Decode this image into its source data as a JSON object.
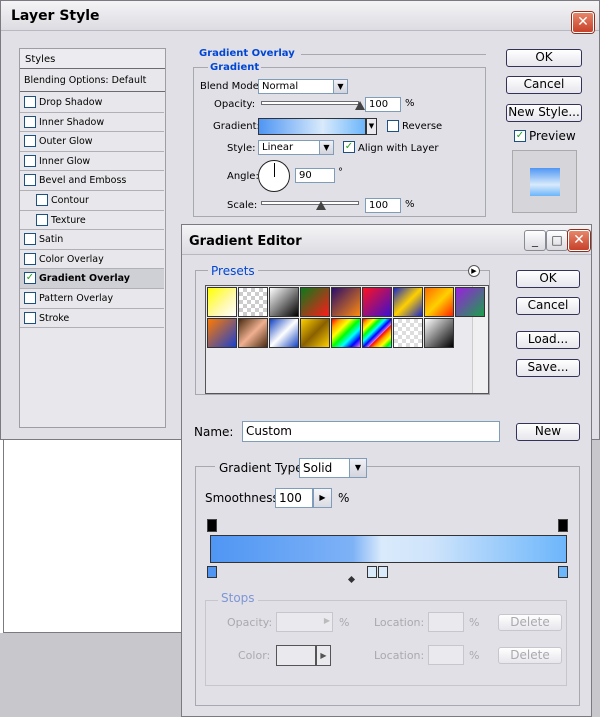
{
  "layer_style": {
    "title": "Layer Style",
    "close": "✕",
    "styles_header": "Styles",
    "blending_options": "Blending Options: Default",
    "effects": [
      {
        "label": "Drop Shadow",
        "checked": false
      },
      {
        "label": "Inner Shadow",
        "checked": false
      },
      {
        "label": "Outer Glow",
        "checked": false
      },
      {
        "label": "Inner Glow",
        "checked": false
      },
      {
        "label": "Bevel and Emboss",
        "checked": false
      },
      {
        "label": "Contour",
        "checked": false
      },
      {
        "label": "Texture",
        "checked": false
      },
      {
        "label": "Satin",
        "checked": false
      },
      {
        "label": "Color Overlay",
        "checked": false
      },
      {
        "label": "Gradient Overlay",
        "checked": true
      },
      {
        "label": "Pattern Overlay",
        "checked": false
      },
      {
        "label": "Stroke",
        "checked": false
      }
    ],
    "section_title": "Gradient Overlay",
    "group_title": "Gradient",
    "blend_mode_label": "Blend Mode:",
    "blend_mode_value": "Normal",
    "opacity_label": "Opacity:",
    "opacity_value": "100",
    "percent": "%",
    "gradient_label": "Gradient:",
    "reverse_label": "Reverse",
    "style_label": "Style:",
    "style_value": "Linear",
    "align_label": "Align with Layer",
    "align_checked": true,
    "angle_label": "Angle:",
    "angle_value": "90",
    "degree": "°",
    "scale_label": "Scale:",
    "scale_value": "100",
    "ok": "OK",
    "cancel": "Cancel",
    "new_style": "New Style...",
    "preview_label": "Preview",
    "preview_checked": true
  },
  "gradient_editor": {
    "title": "Gradient Editor",
    "presets_label": "Presets",
    "ok": "OK",
    "cancel": "Cancel",
    "load": "Load...",
    "save": "Save...",
    "name_label": "Name:",
    "name_value": "Custom",
    "new": "New",
    "gradient_type_label": "Gradient Type:",
    "gradient_type_value": "Solid",
    "smoothness_label": "Smoothness:",
    "smoothness_value": "100",
    "percent": "%",
    "stops_label": "Stops",
    "opacity_label": "Opacity:",
    "location_label": "Location:",
    "color_label": "Color:",
    "delete": "Delete",
    "minimize": "_",
    "maximize": "□",
    "close": "✕"
  },
  "colors": {
    "gradient_start": "#4f96f4",
    "gradient_mid": "#d9eafb",
    "gradient_end": "#6cb6fb",
    "accent": "#0046d5"
  }
}
